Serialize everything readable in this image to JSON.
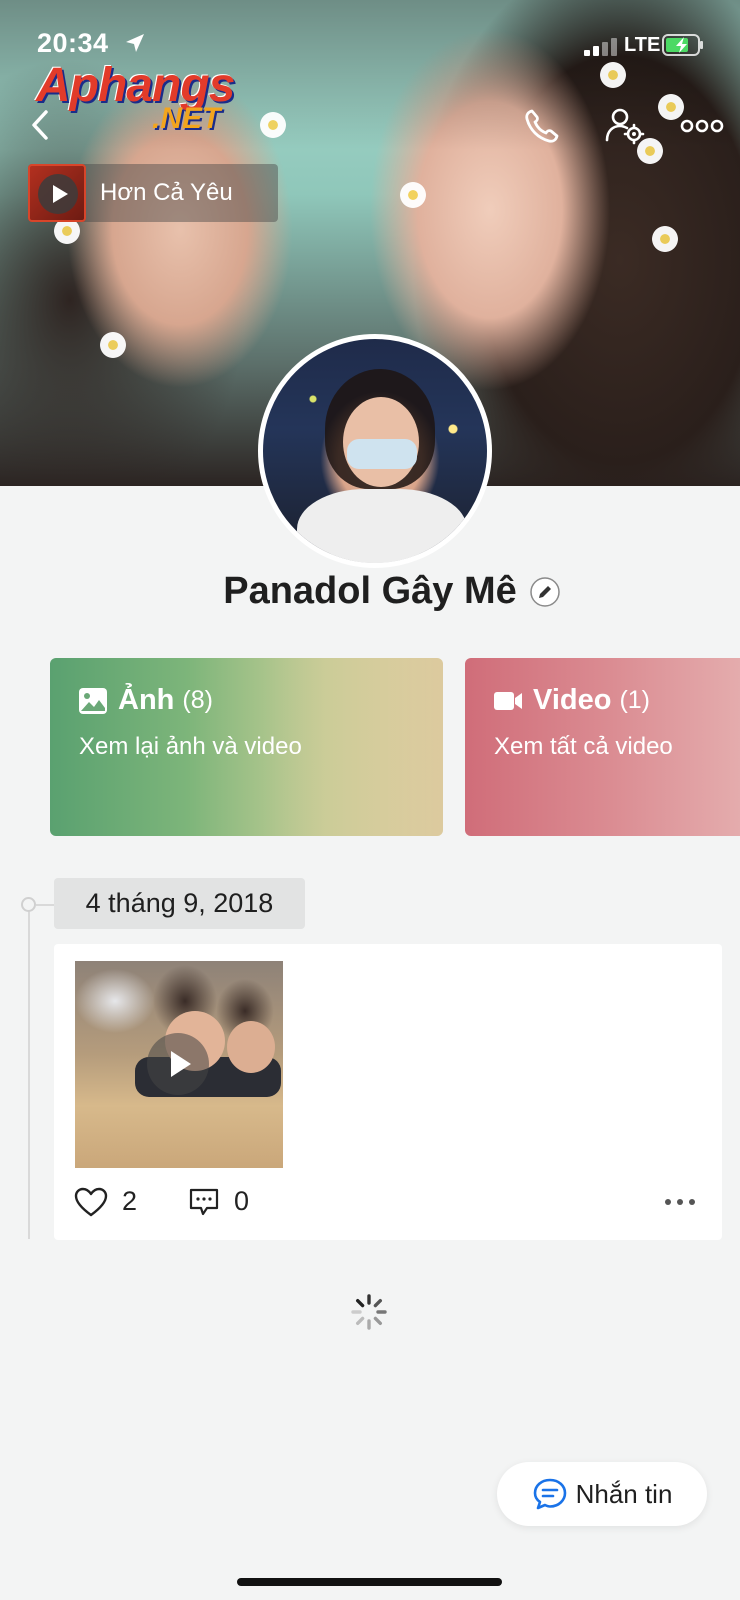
{
  "status_bar": {
    "time": "20:34",
    "network": "LTE"
  },
  "watermark": {
    "main": "Aphangs",
    "sub": ".NET"
  },
  "music": {
    "title": "Hơn Cả Yêu"
  },
  "profile": {
    "name": "Panadol Gây Mê"
  },
  "media_cards": [
    {
      "title": "Ảnh",
      "count": "(8)",
      "subtitle": "Xem lại ảnh và video",
      "icon": "image-icon"
    },
    {
      "title": "Video",
      "count": "(1)",
      "subtitle": "Xem tất cả video",
      "icon": "video-camera-icon"
    }
  ],
  "timeline": {
    "date": "4 tháng 9, 2018",
    "post": {
      "likes": "2",
      "comments": "0"
    }
  },
  "message_button": {
    "label": "Nhắn tin"
  },
  "colors": {
    "photo_card": "#5aa170",
    "video_card": "#d06d79",
    "message_icon": "#1a73e8",
    "background": "#f3f4f4"
  }
}
